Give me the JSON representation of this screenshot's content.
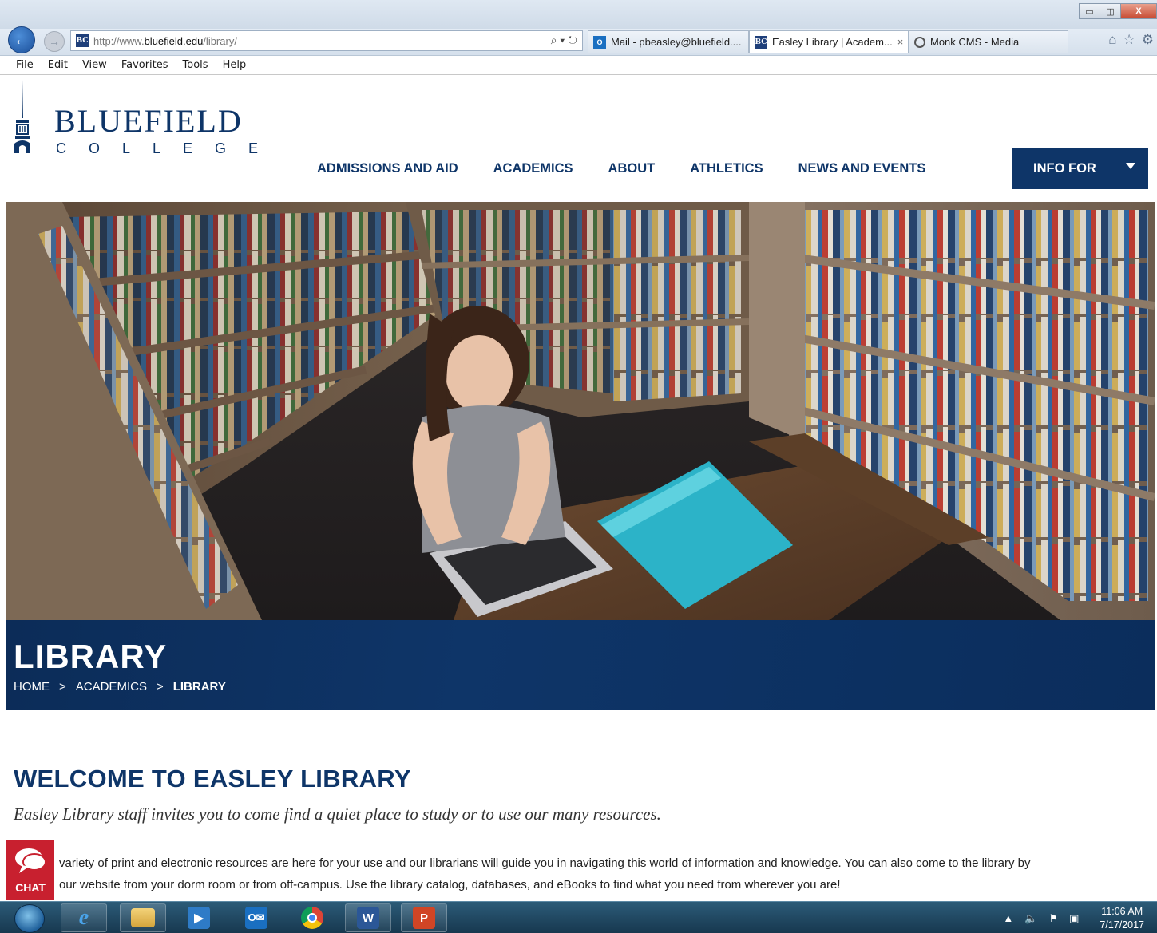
{
  "browser": {
    "url_prefix": "http://www.",
    "url_host": "bluefield.edu",
    "url_path": "/library/",
    "tabs": [
      {
        "label": "Mail - pbeasley@bluefield...."
      },
      {
        "label": "Easley Library | Academ...",
        "close": "×"
      },
      {
        "label": "Monk CMS - Media"
      }
    ],
    "menu": [
      "File",
      "Edit",
      "View",
      "Favorites",
      "Tools",
      "Help"
    ],
    "window_controls": {
      "minimize": "▭",
      "restore": "◫",
      "close": "X"
    }
  },
  "site": {
    "logo_main": "BLUEFIELD",
    "logo_sub": "COLLEGE",
    "nav": [
      "ADMISSIONS AND AID",
      "ACADEMICS",
      "ABOUT",
      "ATHLETICS",
      "NEWS AND EVENTS"
    ],
    "info_for": "INFO FOR"
  },
  "banner": {
    "title": "LIBRARY",
    "breadcrumb": [
      "HOME",
      "ACADEMICS",
      "LIBRARY"
    ],
    "separator": ">"
  },
  "content": {
    "title": "WELCOME TO EASLEY LIBRARY",
    "subtitle": "Easley Library staff invites you to come find a quiet place to study or to use our many resources.",
    "line1": "variety of print and electronic resources are here for your use and our librarians will guide you in navigating this world of information and knowledge. You can also come to the library by",
    "line2": "our website from your dorm room or from off-campus. Use the library catalog, databases, and eBooks to find what you need from wherever you are!"
  },
  "chat": {
    "label": "CHAT"
  },
  "taskbar": {
    "time": "11:06 AM",
    "date": "7/17/2017"
  },
  "colors": {
    "brand_navy": "#0e3568",
    "chat_red": "#c8202f"
  }
}
